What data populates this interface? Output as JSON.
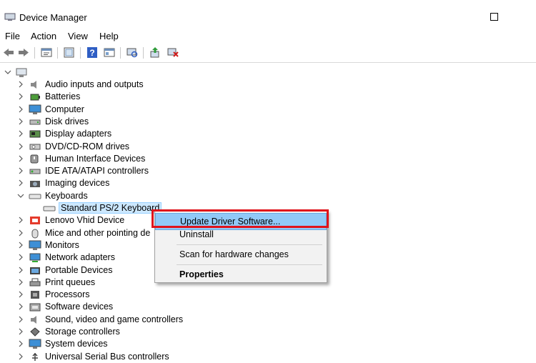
{
  "window": {
    "title": "Device Manager"
  },
  "menu": [
    "File",
    "Action",
    "View",
    "Help"
  ],
  "toolbar": [
    "back-icon",
    "forward-icon",
    "properties-icon",
    "show-hidden-icon",
    "help-icon",
    "grid-icon",
    "scan-icon",
    "update-driver-icon",
    "uninstall-icon"
  ],
  "tree": {
    "items": [
      {
        "label": "Audio inputs and outputs",
        "icon": "speaker-icon",
        "state": "collapsed"
      },
      {
        "label": "Batteries",
        "icon": "battery-icon",
        "state": "collapsed"
      },
      {
        "label": "Computer",
        "icon": "monitor-icon",
        "state": "collapsed"
      },
      {
        "label": "Disk drives",
        "icon": "disk-icon",
        "state": "collapsed"
      },
      {
        "label": "Display adapters",
        "icon": "display-adapter-icon",
        "state": "collapsed"
      },
      {
        "label": "DVD/CD-ROM drives",
        "icon": "dvd-icon",
        "state": "collapsed"
      },
      {
        "label": "Human Interface Devices",
        "icon": "hid-icon",
        "state": "collapsed"
      },
      {
        "label": "IDE ATA/ATAPI controllers",
        "icon": "ide-icon",
        "state": "collapsed"
      },
      {
        "label": "Imaging devices",
        "icon": "camera-icon",
        "state": "collapsed"
      },
      {
        "label": "Keyboards",
        "icon": "keyboard-icon",
        "state": "expanded"
      },
      {
        "label": "Standard PS/2 Keyboard",
        "icon": "keyboard-icon",
        "state": "child"
      },
      {
        "label": "Lenovo Vhid Device",
        "icon": "lenovo-icon",
        "state": "collapsed"
      },
      {
        "label": "Mice and other pointing de",
        "icon": "mouse-icon",
        "state": "collapsed"
      },
      {
        "label": "Monitors",
        "icon": "monitor-icon",
        "state": "collapsed"
      },
      {
        "label": "Network adapters",
        "icon": "network-icon",
        "state": "collapsed"
      },
      {
        "label": "Portable Devices",
        "icon": "portable-icon",
        "state": "collapsed"
      },
      {
        "label": "Print queues",
        "icon": "printer-icon",
        "state": "collapsed"
      },
      {
        "label": "Processors",
        "icon": "processor-icon",
        "state": "collapsed"
      },
      {
        "label": "Software devices",
        "icon": "software-icon",
        "state": "collapsed"
      },
      {
        "label": "Sound, video and game controllers",
        "icon": "speaker-icon",
        "state": "collapsed"
      },
      {
        "label": "Storage controllers",
        "icon": "storage-icon",
        "state": "collapsed"
      },
      {
        "label": "System devices",
        "icon": "monitor-icon",
        "state": "collapsed"
      },
      {
        "label": "Universal Serial Bus controllers",
        "icon": "usb-icon",
        "state": "collapsed"
      }
    ]
  },
  "context_menu": {
    "update": "Update Driver Software...",
    "uninstall": "Uninstall",
    "scan": "Scan for hardware changes",
    "properties": "Properties"
  },
  "colors": {
    "highlight": "#91c9f7",
    "annotation": "#e0131b",
    "selection": "#cce8ff"
  }
}
